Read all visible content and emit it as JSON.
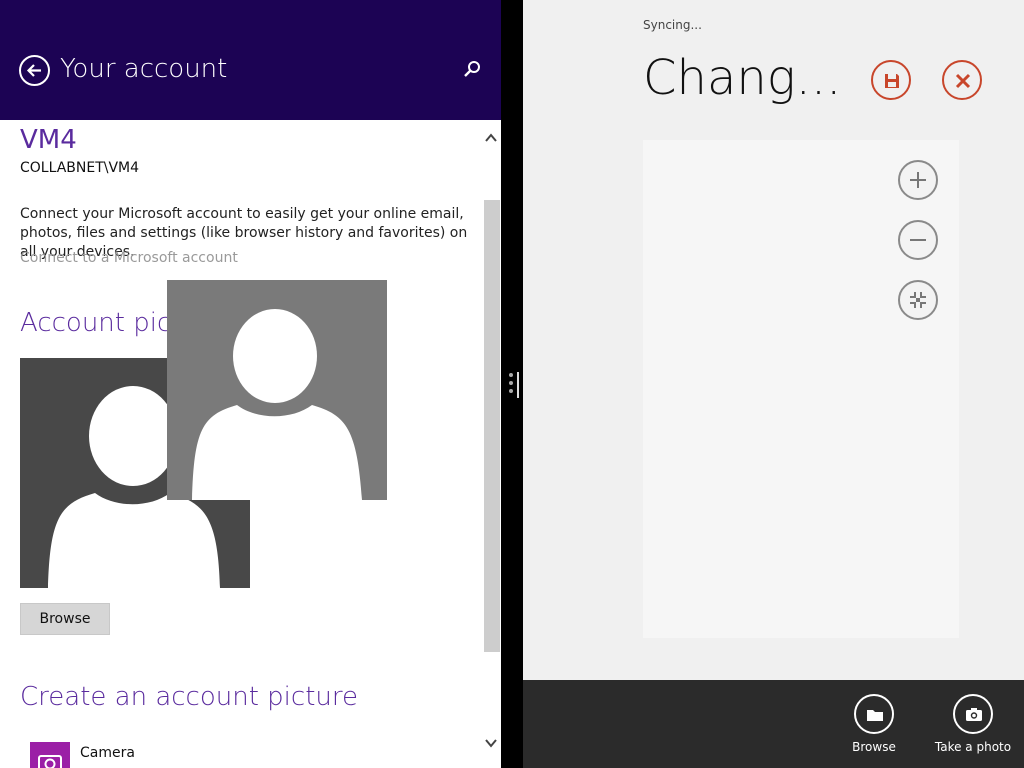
{
  "left_pane": {
    "header": {
      "title": "Your account",
      "back_icon": "back-arrow-icon",
      "search_icon": "search-icon",
      "bg_color": "#1c0354"
    },
    "account": {
      "name": "VM4",
      "domain": "COLLABNET\\VM4",
      "description": "Connect your Microsoft account to easily get your online email, photos, files and settings (like browser history and favorites) on all your devices.",
      "connect_link": "Connect to a Microsoft account"
    },
    "account_picture": {
      "title": "Account picture",
      "browse_label": "Browse"
    },
    "create_picture": {
      "title": "Create an account picture",
      "items": [
        {
          "label": "Camera",
          "icon": "camera-icon"
        }
      ]
    },
    "accent_color": "#5a2b9e"
  },
  "right_pane": {
    "status": "Syncing...",
    "title": "Chang...",
    "save_icon": "save-icon",
    "cancel_icon": "close-icon",
    "zoom_in_icon": "zoom-in-icon",
    "zoom_out_icon": "zoom-out-icon",
    "fit_icon": "crop-fit-icon",
    "accent_color": "#c8462b"
  },
  "app_bar": {
    "buttons": [
      {
        "label": "Browse",
        "icon": "folder-icon"
      },
      {
        "label": "Take a photo",
        "icon": "camera-icon"
      }
    ]
  }
}
